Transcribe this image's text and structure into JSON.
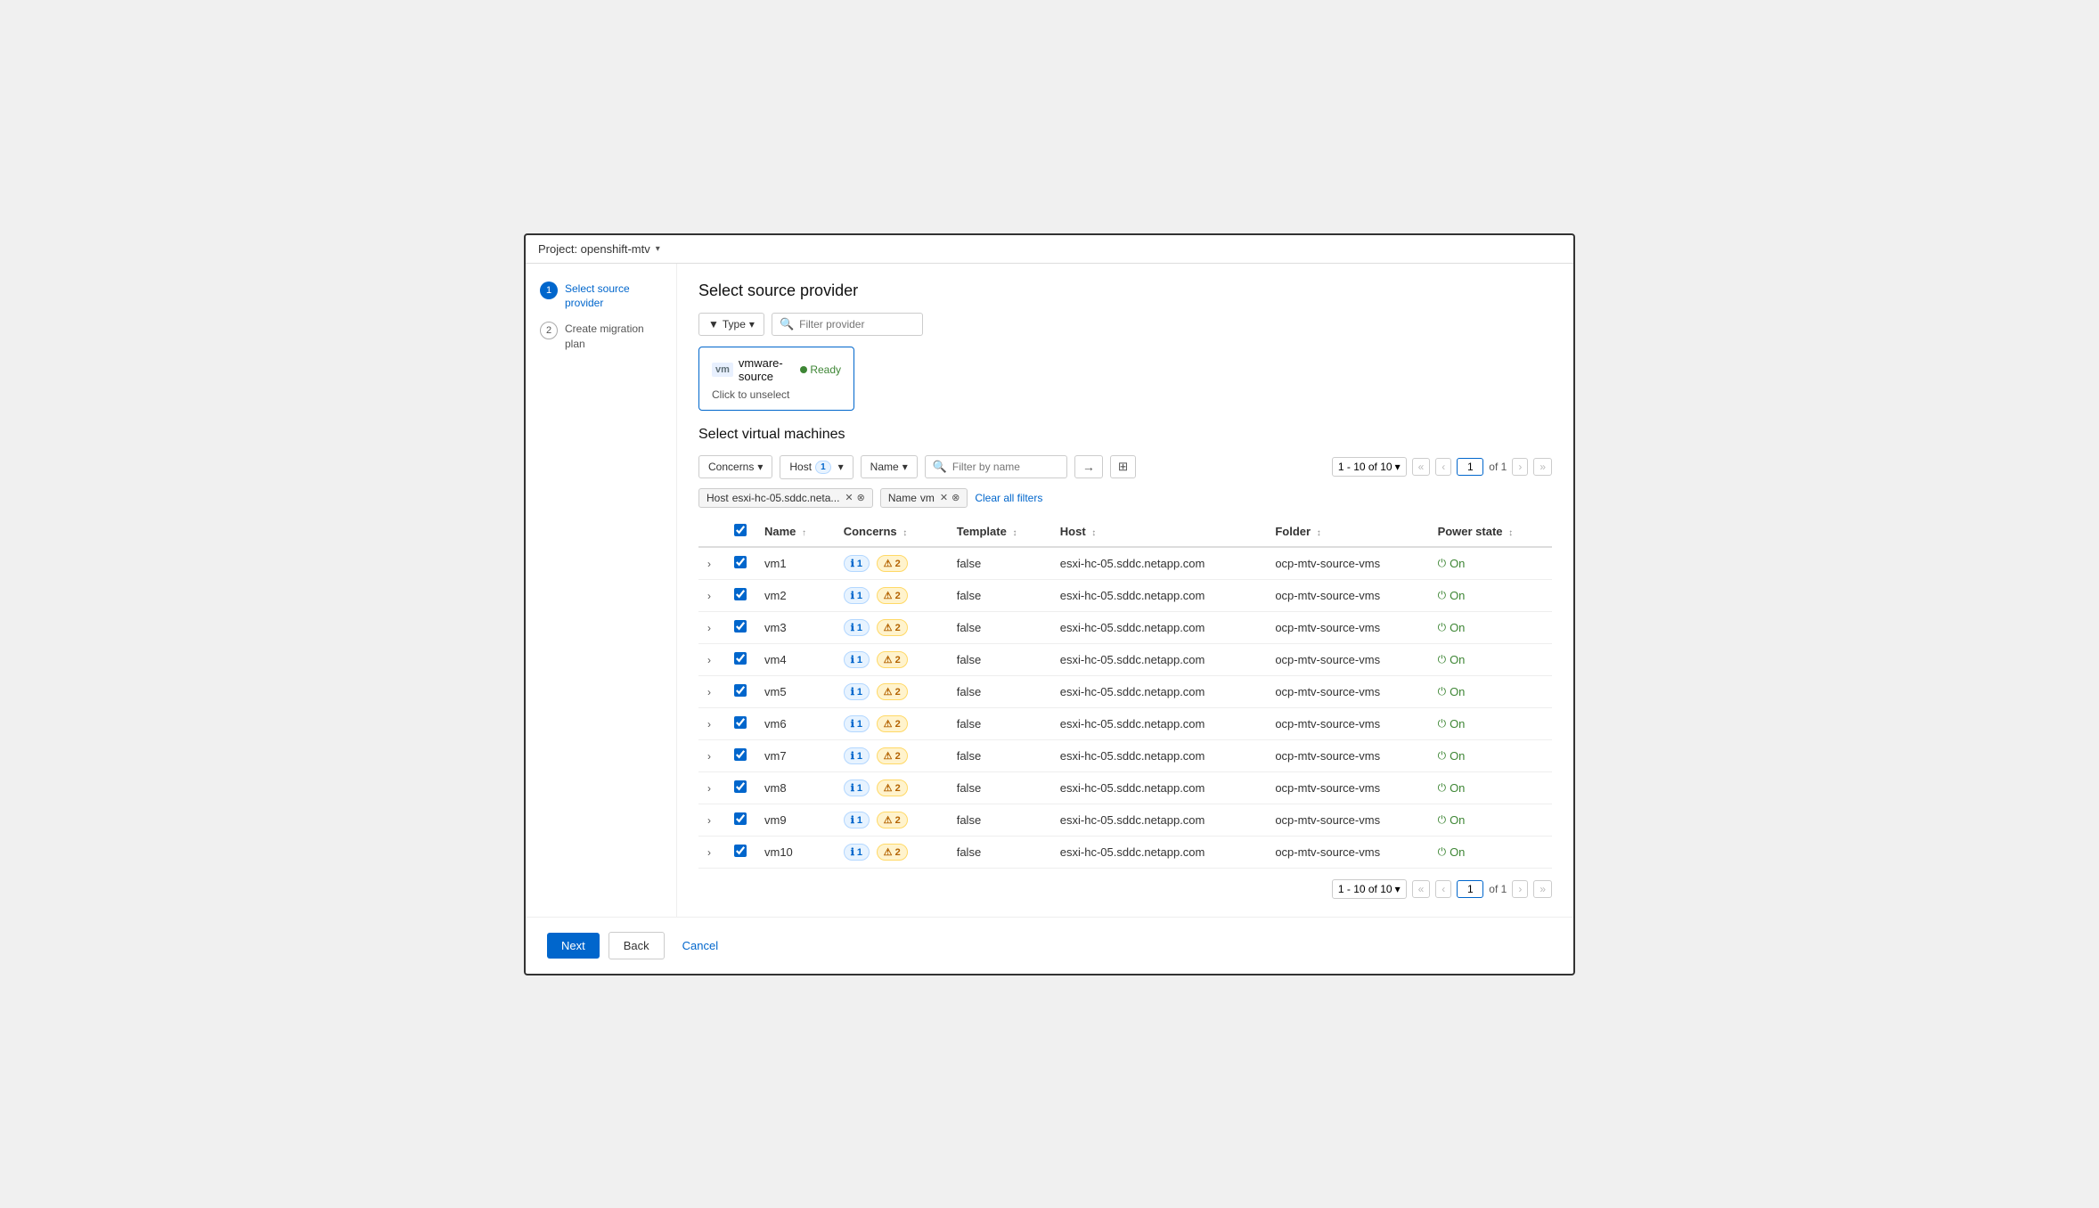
{
  "window": {
    "title": "Project: openshift-mtv"
  },
  "sidebar": {
    "steps": [
      {
        "num": "1",
        "label": "Select source provider",
        "active": true
      },
      {
        "num": "2",
        "label": "Create migration plan",
        "active": false
      }
    ]
  },
  "provider_section": {
    "title": "Select source provider",
    "type_filter_label": "Type",
    "filter_placeholder": "Filter provider",
    "provider_card": {
      "name": "vmware-source",
      "status": "Ready",
      "unselect_label": "Click to unselect"
    }
  },
  "vm_section": {
    "title": "Select virtual machines",
    "filters": {
      "concerns_label": "Concerns",
      "host_label": "Host",
      "host_count": "1",
      "name_label": "Name",
      "filter_placeholder": "Filter by name"
    },
    "active_filters": {
      "host_label": "Host",
      "host_value": "esxi-hc-05.sddc.neta...",
      "name_label": "Name",
      "name_value": "vm",
      "clear_all": "Clear all filters"
    },
    "pagination": {
      "range": "1 - 10 of 10",
      "of_label": "of 1",
      "current_page": "1"
    },
    "table": {
      "columns": [
        {
          "key": "name",
          "label": "Name",
          "sortable": true
        },
        {
          "key": "concerns",
          "label": "Concerns",
          "sortable": true
        },
        {
          "key": "template",
          "label": "Template",
          "sortable": true
        },
        {
          "key": "host",
          "label": "Host",
          "sortable": true
        },
        {
          "key": "folder",
          "label": "Folder",
          "sortable": true
        },
        {
          "key": "power_state",
          "label": "Power state",
          "sortable": true
        }
      ],
      "rows": [
        {
          "name": "vm1",
          "info_count": "1",
          "warn_count": "2",
          "template": "false",
          "host": "esxi-hc-05.sddc.netapp.com",
          "folder": "ocp-mtv-source-vms",
          "power_state": "On"
        },
        {
          "name": "vm2",
          "info_count": "1",
          "warn_count": "2",
          "template": "false",
          "host": "esxi-hc-05.sddc.netapp.com",
          "folder": "ocp-mtv-source-vms",
          "power_state": "On"
        },
        {
          "name": "vm3",
          "info_count": "1",
          "warn_count": "2",
          "template": "false",
          "host": "esxi-hc-05.sddc.netapp.com",
          "folder": "ocp-mtv-source-vms",
          "power_state": "On"
        },
        {
          "name": "vm4",
          "info_count": "1",
          "warn_count": "2",
          "template": "false",
          "host": "esxi-hc-05.sddc.netapp.com",
          "folder": "ocp-mtv-source-vms",
          "power_state": "On"
        },
        {
          "name": "vm5",
          "info_count": "1",
          "warn_count": "2",
          "template": "false",
          "host": "esxi-hc-05.sddc.netapp.com",
          "folder": "ocp-mtv-source-vms",
          "power_state": "On"
        },
        {
          "name": "vm6",
          "info_count": "1",
          "warn_count": "2",
          "template": "false",
          "host": "esxi-hc-05.sddc.netapp.com",
          "folder": "ocp-mtv-source-vms",
          "power_state": "On"
        },
        {
          "name": "vm7",
          "info_count": "1",
          "warn_count": "2",
          "template": "false",
          "host": "esxi-hc-05.sddc.netapp.com",
          "folder": "ocp-mtv-source-vms",
          "power_state": "On"
        },
        {
          "name": "vm8",
          "info_count": "1",
          "warn_count": "2",
          "template": "false",
          "host": "esxi-hc-05.sddc.netapp.com",
          "folder": "ocp-mtv-source-vms",
          "power_state": "On"
        },
        {
          "name": "vm9",
          "info_count": "1",
          "warn_count": "2",
          "template": "false",
          "host": "esxi-hc-05.sddc.netapp.com",
          "folder": "ocp-mtv-source-vms",
          "power_state": "On"
        },
        {
          "name": "vm10",
          "info_count": "1",
          "warn_count": "2",
          "template": "false",
          "host": "esxi-hc-05.sddc.netapp.com",
          "folder": "ocp-mtv-source-vms",
          "power_state": "On"
        }
      ]
    }
  },
  "footer": {
    "next_label": "Next",
    "back_label": "Back",
    "cancel_label": "Cancel"
  }
}
